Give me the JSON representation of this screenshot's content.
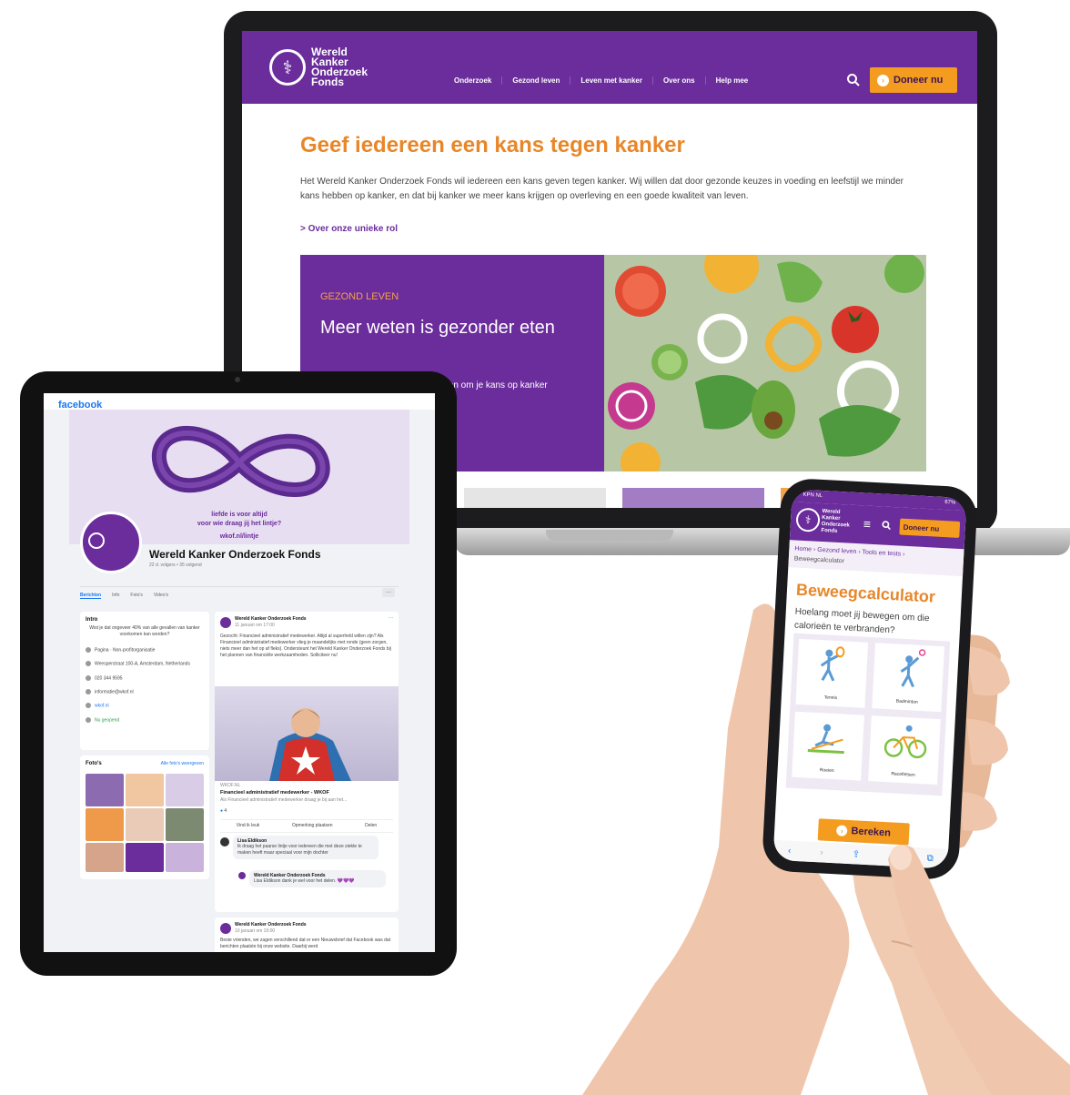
{
  "laptop_site": {
    "logo_lines": [
      "Wereld",
      "Kanker",
      "Onderzoek",
      "Fonds"
    ],
    "nav": [
      "Onderzoek",
      "Gezond leven",
      "Leven met kanker",
      "Over ons",
      "Help mee"
    ],
    "donate_label": "Doneer nu",
    "hero_title": "Geef iedereen een kans tegen kanker",
    "hero_body": "Het Wereld Kanker Onderzoek Fonds wil iedereen een kans geven tegen kanker. Wij willen dat door gezonde keuzes in voeding en leefstijl we minder kans hebben op kanker, en dat bij kanker we meer kans krijgen op overleving en een goede kwaliteit van leven.",
    "hero_link": "> Over onze unieke rol",
    "promo_kicker": "GEZOND LEVEN",
    "promo_title": "Meer weten is gezonder eten",
    "promo_text": "ten om je kans op kanker"
  },
  "facebook": {
    "logo": "facebook",
    "cover_line1": "liefde is voor altijd",
    "cover_line2": "voor wie draag jij het lintje?",
    "cover_url": "wkof.nl/lintje",
    "page_name": "Wereld Kanker Onderzoek Fonds",
    "page_meta": "22 d. volgers • 35 volgend",
    "tabs": [
      "Berichten",
      "Info",
      "Foto's",
      "Video's"
    ],
    "intro_title": "Intro",
    "intro_text": "Wist je dat ongeveer 40% van alle gevallen van kanker voorkomen kan worden?",
    "intro_rows": [
      "Pagina · Non-profitorganisatie",
      "Weesperstraat 100-A, Amsterdam, Netherlands",
      "020 344 9595",
      "informatie@wkof.nl",
      "wkof.nl",
      "Nu geopend"
    ],
    "photos_title": "Foto's",
    "photos_link": "Alle foto's weergeven",
    "post_author": "Wereld Kanker Onderzoek Fonds",
    "post_date": "11 januari om 17:00",
    "post_text": "Gezocht: Financieel administratief medewerker. Altijd al superheld willen zijn? Als Financieel administratief medewerker vlieg je maandelijks met ronde (geen zorgen, niets meer dan het op af fleks). Ondersteunt het Wereld Kanker Onderzoek Fonds bij het plannen van financiële werkzaamheden. Solliciteer nu!",
    "post_link_domain": "WKOF.NL",
    "post_link_title": "Financieel administratief medewerker - WKOF",
    "post_link_desc": "Als Financieel administratief medewerker draag je bij aan het...",
    "reactions_count": "4",
    "post_actions": [
      "Vind ik leuk",
      "Opmerking plaatsen",
      "Delen"
    ],
    "comment_author": "Lisa Eldikson",
    "comment_text": "Ik draag het paarse lintje voor iedereen die met deze ziekte te maken heeft maar speciaal voor mijn dochter",
    "reply_author": "Wereld Kanker Onderzoek Fonds",
    "reply_text": "Lisa Eldikson dank je wel voor het delen. 💜💜💜",
    "post2_author": "Wereld Kanker Onderzoek Fonds",
    "post2_date": "10 januari om 10:00",
    "post2_text": "Beste vrienden, we zagen verschillend dat er een Nieuwsbrief dat Facebook was dat berichten plaatste bij onze website. Daarbij werd"
  },
  "phone": {
    "status_left": "KPN NL",
    "status_right": "67%",
    "donate_label": "Doneer nu",
    "breadcrumb_1": "Home › Gezond leven › Tools en tests ›",
    "breadcrumb_2": "Beweegcalculator",
    "title": "Beweegcalculator",
    "question": "Hoelang moet jij bewegen om die calorieën te verbranden?",
    "activities": [
      "Tennis",
      "Badminton",
      "Roeien",
      "Racefietsen"
    ],
    "calc_label": "Bereken"
  },
  "colors": {
    "purple": "#6b2c9c",
    "orange": "#f39c1f",
    "title_orange": "#e8872a",
    "fb_blue": "#1877f2"
  }
}
